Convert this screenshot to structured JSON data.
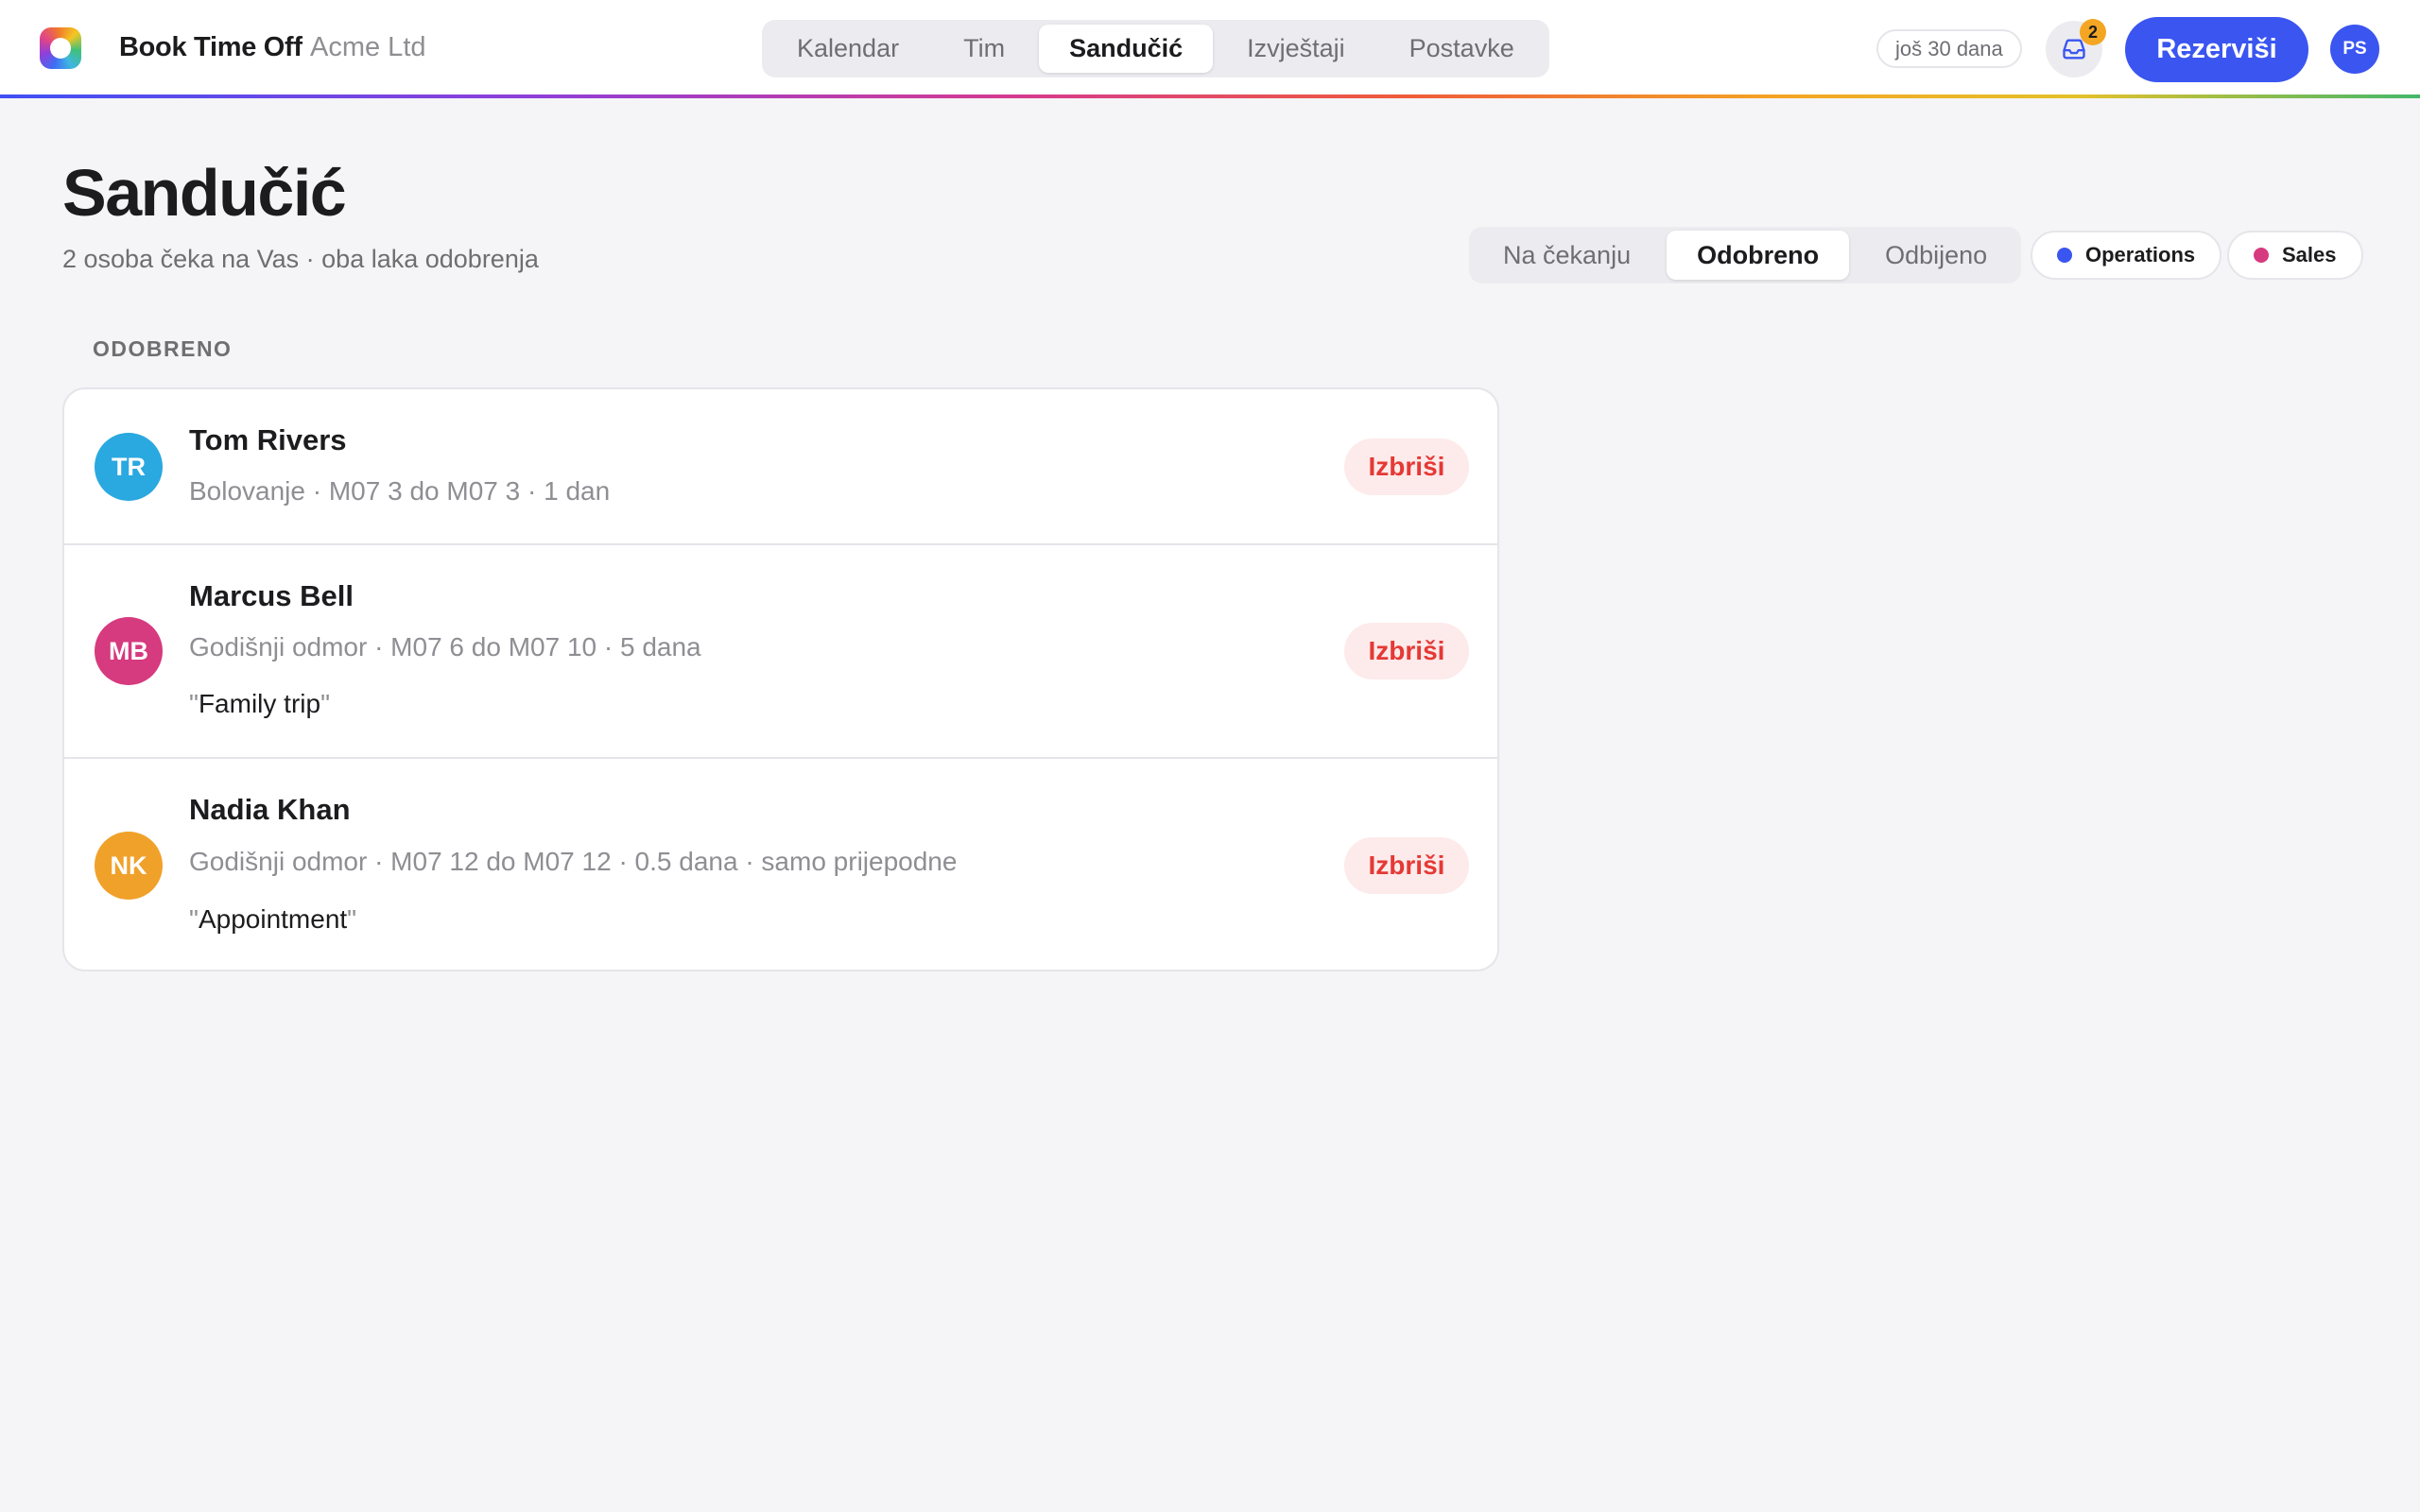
{
  "header": {
    "brand": "Book Time Off",
    "org": "Acme Ltd",
    "nav_tabs": [
      {
        "label": "Kalendar",
        "active": false
      },
      {
        "label": "Tim",
        "active": false
      },
      {
        "label": "Sandučić",
        "active": true
      },
      {
        "label": "Izvještaji",
        "active": false
      },
      {
        "label": "Postavke",
        "active": false
      }
    ],
    "trial_label": "još 30 dana",
    "inbox_icon": "inbox-icon",
    "inbox_count": "2",
    "book_label": "Rezerviši",
    "user_initials": "PS",
    "colors": {
      "accent": "#3a55f0",
      "badge": "#f4a623"
    }
  },
  "page": {
    "title": "Sandučić",
    "subtitle": "2 osoba čeka na Vas · oba laka odobrenja",
    "filters": [
      {
        "label": "Na čekanju",
        "active": false
      },
      {
        "label": "Odobreno",
        "active": true
      },
      {
        "label": "Odbijeno",
        "active": false
      }
    ],
    "teams": [
      {
        "label": "Operations",
        "color": "#3a55f0"
      },
      {
        "label": "Sales",
        "color": "#d63a7f"
      }
    ]
  },
  "list": {
    "section_label": "ODOBRENO",
    "items": [
      {
        "initials": "TR",
        "avatar_color": "#2aa8e0",
        "name": "Tom Rivers",
        "meta": "Bolovanje · M07 3 do M07 3 · 1 dan",
        "note": "",
        "action": "Izbriši"
      },
      {
        "initials": "MB",
        "avatar_color": "#d63a7f",
        "name": "Marcus Bell",
        "meta": "Godišnji odmor · M07 6 do M07 10 · 5 dana",
        "note": "Family trip",
        "action": "Izbriši"
      },
      {
        "initials": "NK",
        "avatar_color": "#f0a12a",
        "name": "Nadia Khan",
        "meta": "Godišnji odmor · M07 12 do M07 12 · 0.5 dana · samo prijepodne",
        "note": "Appointment",
        "action": "Izbriši"
      }
    ]
  }
}
